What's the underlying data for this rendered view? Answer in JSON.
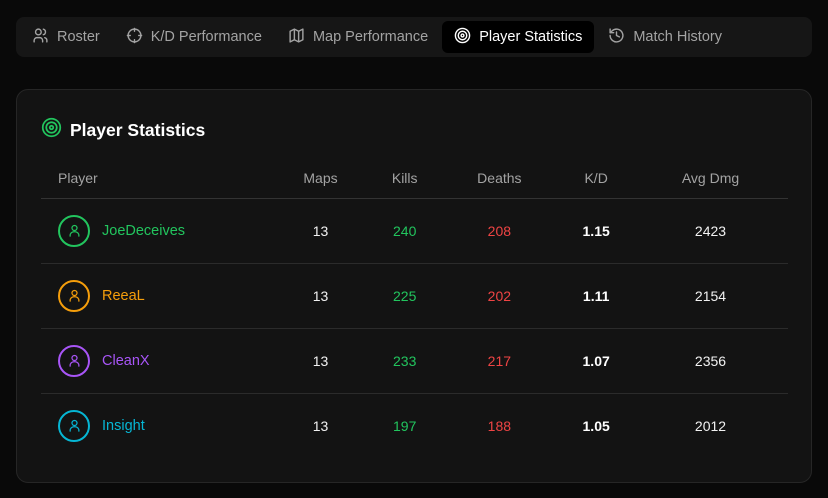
{
  "tabs": [
    {
      "label": "Roster",
      "icon": "users-icon",
      "active": false
    },
    {
      "label": "K/D Performance",
      "icon": "crosshair-icon",
      "active": false
    },
    {
      "label": "Map Performance",
      "icon": "map-icon",
      "active": false
    },
    {
      "label": "Player Statistics",
      "icon": "target-icon",
      "active": true
    },
    {
      "label": "Match History",
      "icon": "history-icon",
      "active": false
    }
  ],
  "card": {
    "title": "Player Statistics",
    "title_icon": "target-icon",
    "title_icon_color": "#22c55e"
  },
  "table": {
    "headers": {
      "player": "Player",
      "maps": "Maps",
      "kills": "Kills",
      "deaths": "Deaths",
      "kd": "K/D",
      "avg_dmg": "Avg Dmg"
    },
    "rows": [
      {
        "name": "JoeDeceives",
        "color": "#22c55e",
        "maps": "13",
        "kills": "240",
        "deaths": "208",
        "kd": "1.15",
        "avg_dmg": "2423"
      },
      {
        "name": "ReeaL",
        "color": "#f59e0b",
        "maps": "13",
        "kills": "225",
        "deaths": "202",
        "kd": "1.11",
        "avg_dmg": "2154"
      },
      {
        "name": "CleanX",
        "color": "#a855f7",
        "maps": "13",
        "kills": "233",
        "deaths": "217",
        "kd": "1.07",
        "avg_dmg": "2356"
      },
      {
        "name": "Insight",
        "color": "#06b6d4",
        "maps": "13",
        "kills": "197",
        "deaths": "188",
        "kd": "1.05",
        "avg_dmg": "2012"
      }
    ],
    "kills_color": "#22c55e",
    "deaths_color": "#ef4444"
  }
}
